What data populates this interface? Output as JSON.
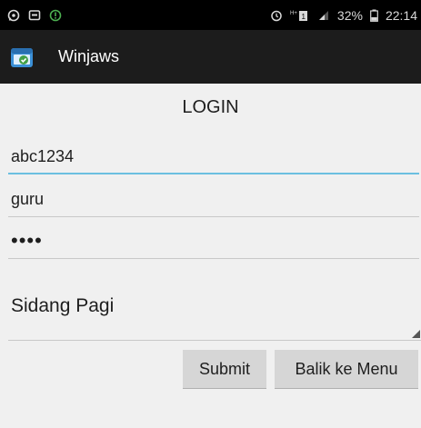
{
  "status_bar": {
    "battery": "32%",
    "time": "22:14"
  },
  "app": {
    "title": "Winjaws"
  },
  "form": {
    "heading": "LOGIN",
    "username": "abc1234",
    "role": "guru",
    "password_masked": "••••",
    "session": "Sidang Pagi"
  },
  "buttons": {
    "submit": "Submit",
    "back_to_menu": "Balik ke Menu"
  },
  "colors": {
    "status_bar_bg": "#000000",
    "action_bar_bg": "#1c1c1c",
    "focus_underline": "#6bbfe0",
    "page_bg": "#f0f0f0"
  }
}
